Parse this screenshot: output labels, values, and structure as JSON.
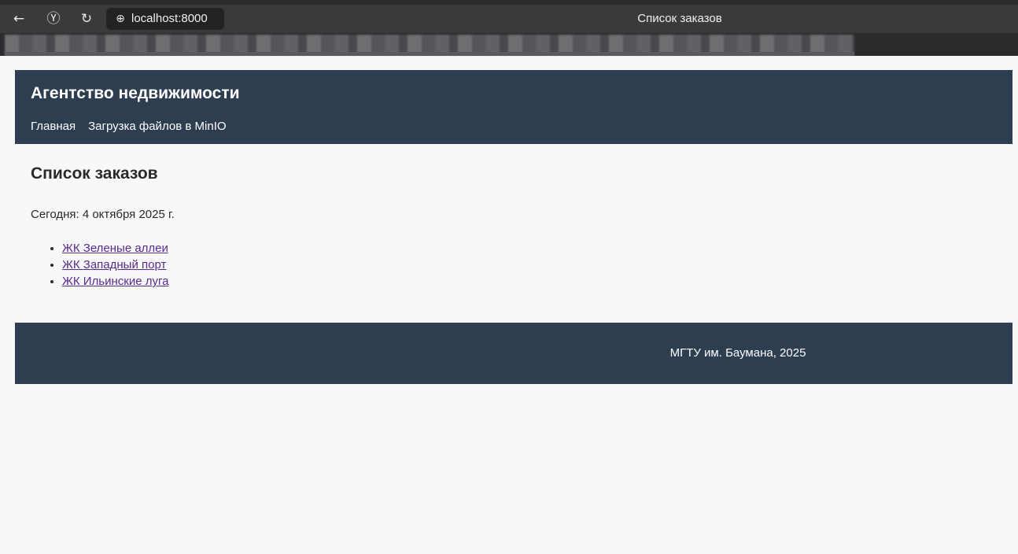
{
  "browser": {
    "address": "localhost:8000",
    "tab_title": "Список заказов",
    "icons": [
      "back-icon",
      "yandex-icon",
      "reload-icon",
      "globe-icon"
    ]
  },
  "header": {
    "site_title": "Агентство недвижимости",
    "nav": [
      "Главная",
      "Загрузка файлов в MinIO"
    ]
  },
  "main": {
    "title": "Список заказов",
    "today": "Сегодня: 4 октября 2025 г.",
    "orders": [
      "ЖК Зеленые аллеи",
      "ЖК Западный порт",
      "ЖК Ильинские луга"
    ]
  },
  "footer": {
    "text": "МГТУ им. Баумана, 2025"
  },
  "colors": {
    "header_bg": "#2d3e50",
    "page_bg": "#f6f8fa",
    "link": "#5a2b8c"
  }
}
